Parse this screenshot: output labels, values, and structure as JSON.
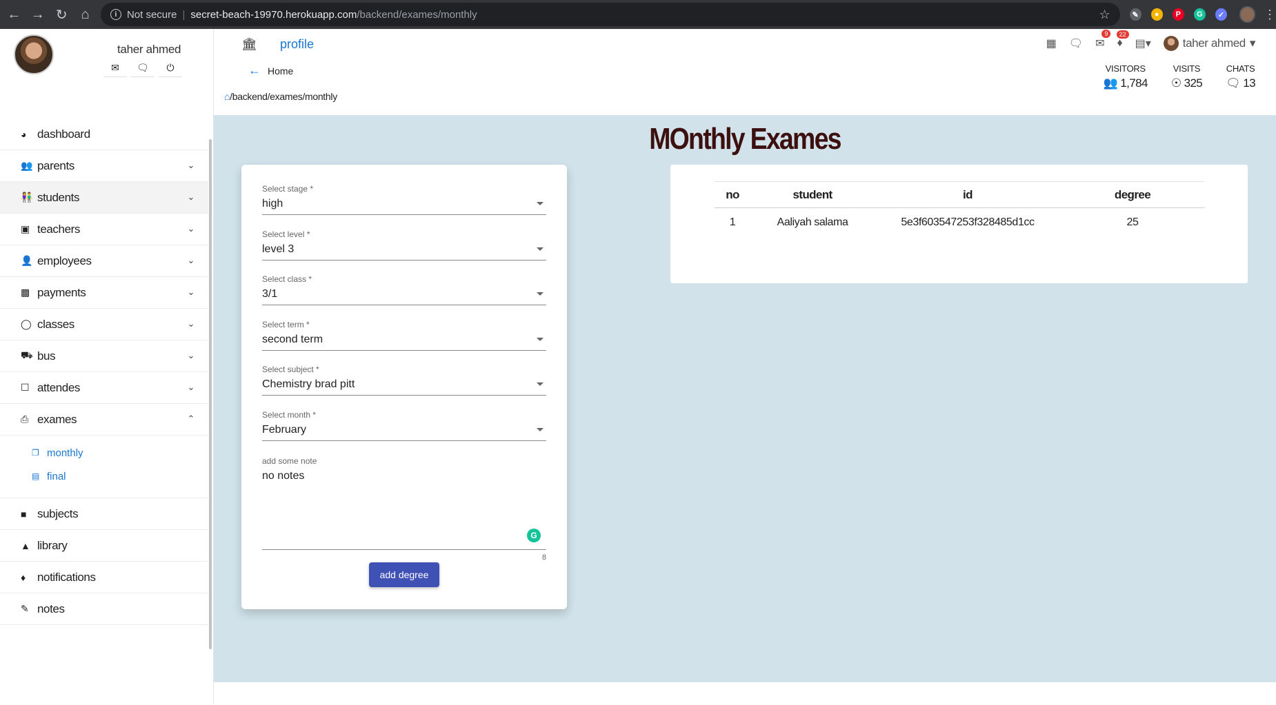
{
  "browser": {
    "not_secure": "Not secure",
    "url_host": "secret-beach-19970.herokuapp.com",
    "url_path": "/backend/exames/monthly"
  },
  "sidebar": {
    "user_name": "taher ahmed",
    "menu": [
      {
        "label": "dashboard",
        "icon": "tachometer-icon",
        "expandable": false
      },
      {
        "label": "parents",
        "icon": "users-icon",
        "expandable": true
      },
      {
        "label": "students",
        "icon": "children-icon",
        "expandable": true
      },
      {
        "label": "teachers",
        "icon": "chalkboard-teacher-icon",
        "expandable": true
      },
      {
        "label": "employees",
        "icon": "user-icon",
        "expandable": true
      },
      {
        "label": "payments",
        "icon": "wallet-icon",
        "expandable": true
      },
      {
        "label": "classes",
        "icon": "lightbulb-icon",
        "expandable": true
      },
      {
        "label": "bus",
        "icon": "bus-icon",
        "expandable": true
      },
      {
        "label": "attendes",
        "icon": "clipboard-icon",
        "expandable": true
      },
      {
        "label": "exames",
        "icon": "file-export-icon",
        "expandable": true,
        "expanded": true
      }
    ],
    "exames_sub": [
      {
        "label": "monthly",
        "icon": "copy-icon"
      },
      {
        "label": "final",
        "icon": "file-icon"
      }
    ],
    "menu_bottom": [
      {
        "label": "subjects",
        "icon": "book-icon"
      },
      {
        "label": "library",
        "icon": "book-reader-icon"
      },
      {
        "label": "notifications",
        "icon": "bell-icon"
      },
      {
        "label": "notes",
        "icon": "pen-icon"
      }
    ]
  },
  "topbar": {
    "profile_label": "profile",
    "back_label": "Home",
    "breadcrumb": "/backend/exames/monthly",
    "mail_badge": "9",
    "bell_badge": "22",
    "user_name": "taher ahmed",
    "stats": [
      {
        "label": "VISITORS",
        "value": "1,784",
        "icon": "users-icon"
      },
      {
        "label": "VISITS",
        "value": "325",
        "icon": "globe-icon"
      },
      {
        "label": "CHATS",
        "value": "13",
        "icon": "comments-icon"
      }
    ]
  },
  "main": {
    "title": "MOnthly Exames",
    "form": {
      "fields": [
        {
          "label": "Select stage *",
          "value": "high"
        },
        {
          "label": "Select level *",
          "value": "level 3"
        },
        {
          "label": "Select class *",
          "value": "3/1"
        },
        {
          "label": "Select term *",
          "value": "second term"
        },
        {
          "label": "Select subject *",
          "value": "Chemistry brad pitt"
        },
        {
          "label": "Select month *",
          "value": "February"
        }
      ],
      "note_label": "add some note",
      "note_value": "no notes",
      "note_counter": "8",
      "submit_label": "add degree"
    },
    "table": {
      "headers": [
        "no",
        "student",
        "id",
        "degree"
      ],
      "rows": [
        [
          "1",
          "Aaliyah salama",
          "5e3f603547253f328485d1cc",
          "25"
        ]
      ]
    }
  }
}
